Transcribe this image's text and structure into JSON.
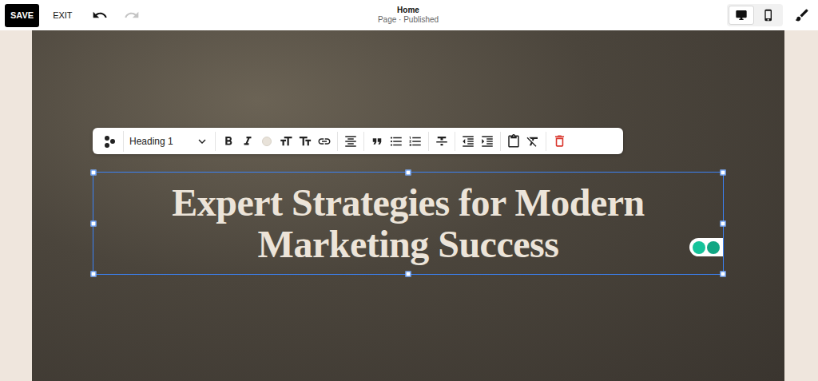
{
  "topbar": {
    "save": "SAVE",
    "exit": "EXIT",
    "history": {
      "undo_disabled": false,
      "redo_disabled": true
    },
    "page_title": "Home",
    "page_status": "Page · Published",
    "devices": [
      {
        "kind": "desktop",
        "selected": true
      },
      {
        "kind": "mobile",
        "selected": false
      }
    ]
  },
  "toolbar": {
    "style": "Heading 1"
  },
  "heading": {
    "text": "Expert Strategies for Modern Marketing Success",
    "selected": true
  }
}
